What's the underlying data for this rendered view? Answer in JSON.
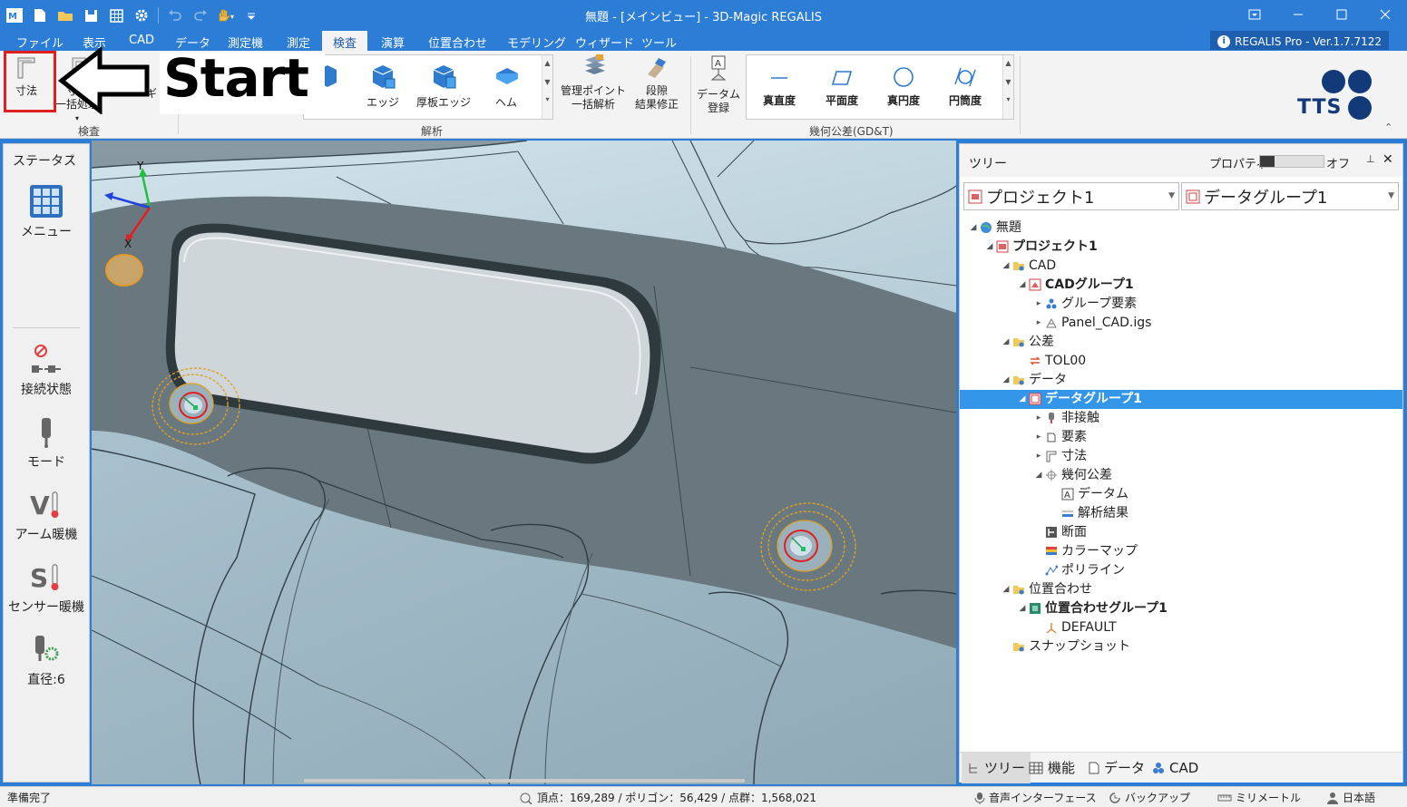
{
  "window": {
    "title": "無題 - [メインビュー] - 3D-Magic REGALIS",
    "version_badge": "REGALIS Pro - Ver.1.7.7122"
  },
  "menu_tabs": [
    "ファイル",
    "表示",
    "CAD",
    "データ",
    "測定機",
    "測定",
    "検査",
    "演算",
    "位置合わせ",
    "モデリング",
    "ウィザード",
    "ツール"
  ],
  "active_tab": "検査",
  "ribbon": {
    "btn_dimension": "寸法",
    "btn_dimension_batch": [
      "寸法",
      "一括処理"
    ],
    "btn_partial_ki": "ギ",
    "btn_edge": "エッジ",
    "btn_thick_edge": "厚板エッジ",
    "btn_hem": "ヘム",
    "btn_mgmt_point": [
      "管理ポイント",
      "一括解析"
    ],
    "btn_step": [
      "段隙",
      "結果修正"
    ],
    "btn_datum_reg": [
      "データム",
      "登録"
    ],
    "btn_straightness": "真直度",
    "btn_flatness": "平面度",
    "btn_roundness": "真円度",
    "btn_cylindricity": "円筒度",
    "group_inspection": "検査",
    "group_analysis": "解析",
    "group_gdt": "幾何公差(GD&T)",
    "logo_text": "TTS"
  },
  "overlay_text": "Start",
  "left_panel": {
    "title": "ステータス",
    "menu": "メニュー",
    "connection": "接続状態",
    "mode": "モード",
    "arm_warm": "アーム暖機",
    "sensor_warm": "センサー暖機",
    "diameter": "直径:6"
  },
  "viewport": {
    "axis_y": "Y",
    "axis_x": "X"
  },
  "right_panel": {
    "tree_title": "ツリー",
    "property_label": "プロパティ",
    "property_state": "オフ",
    "combo_project": "プロジェクト1",
    "combo_datagroup": "データグループ1",
    "tree": [
      {
        "label": "無題",
        "level": 0,
        "exp": "down",
        "bold": false,
        "icon": "globe"
      },
      {
        "label": "プロジェクト1",
        "level": 1,
        "exp": "down",
        "bold": true,
        "icon": "project"
      },
      {
        "label": "CAD",
        "level": 2,
        "exp": "down",
        "bold": false,
        "icon": "folder"
      },
      {
        "label": "CADグループ1",
        "level": 3,
        "exp": "down",
        "bold": true,
        "icon": "cadgroup"
      },
      {
        "label": "グループ要素",
        "level": 4,
        "exp": "right",
        "bold": false,
        "icon": "elements"
      },
      {
        "label": "Panel_CAD.igs",
        "level": 4,
        "exp": "right",
        "bold": false,
        "icon": "mesh"
      },
      {
        "label": "公差",
        "level": 2,
        "exp": "down",
        "bold": false,
        "icon": "folder"
      },
      {
        "label": "TOL00",
        "level": 3,
        "exp": "none",
        "bold": false,
        "icon": "tol"
      },
      {
        "label": "データ",
        "level": 2,
        "exp": "down",
        "bold": false,
        "icon": "folder"
      },
      {
        "label": "データグループ1",
        "level": 3,
        "exp": "down",
        "bold": true,
        "icon": "datagroup",
        "selected": true
      },
      {
        "label": "非接触",
        "level": 4,
        "exp": "right",
        "bold": false,
        "icon": "probe"
      },
      {
        "label": "要素",
        "level": 4,
        "exp": "right",
        "bold": false,
        "icon": "cube"
      },
      {
        "label": "寸法",
        "level": 4,
        "exp": "right",
        "bold": false,
        "icon": "dim"
      },
      {
        "label": "幾何公差",
        "level": 4,
        "exp": "down",
        "bold": false,
        "icon": "gdt"
      },
      {
        "label": "データム",
        "level": 5,
        "exp": "none",
        "bold": false,
        "icon": "datum"
      },
      {
        "label": "解析結果",
        "level": 5,
        "exp": "none",
        "bold": false,
        "icon": "result"
      },
      {
        "label": "断面",
        "level": 4,
        "exp": "none",
        "bold": false,
        "icon": "section"
      },
      {
        "label": "カラーマップ",
        "level": 4,
        "exp": "none",
        "bold": false,
        "icon": "colormap"
      },
      {
        "label": "ポリライン",
        "level": 4,
        "exp": "none",
        "bold": false,
        "icon": "polyline"
      },
      {
        "label": "位置合わせ",
        "level": 2,
        "exp": "down",
        "bold": false,
        "icon": "folder"
      },
      {
        "label": "位置合わせグループ1",
        "level": 3,
        "exp": "down",
        "bold": true,
        "icon": "aligngroup"
      },
      {
        "label": "DEFAULT",
        "level": 4,
        "exp": "none",
        "bold": false,
        "icon": "axis"
      },
      {
        "label": "スナップショット",
        "level": 2,
        "exp": "none",
        "bold": false,
        "icon": "folder"
      }
    ],
    "bottom_tabs": [
      "ツリー",
      "機能",
      "データ",
      "CAD"
    ]
  },
  "statusbar": {
    "ready": "準備完了",
    "stats": "頂点：169,289 / ポリゴン：56,429 / 点群：1,568,021",
    "voice": "音声インターフェース",
    "backup": "バックアップ",
    "unit": "ミリメートル",
    "lang": "日本語"
  },
  "colors": {
    "titlebar": "#2b7dd6",
    "selection": "#3396e8",
    "highlight_box": "#e02020",
    "blue_icon": "#2e7bd0"
  }
}
